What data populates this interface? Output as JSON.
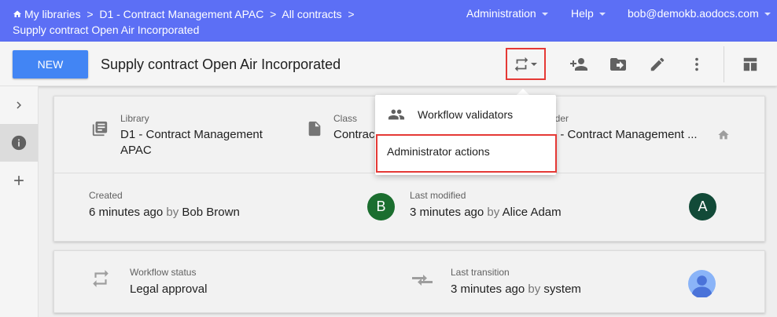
{
  "breadcrumb": {
    "items": [
      "My libraries",
      "D1 - Contract Management APAC",
      "All contracts"
    ],
    "separator": ">",
    "current": "Supply contract Open Air Incorporated"
  },
  "topmenu": {
    "administration": "Administration",
    "help": "Help",
    "user": "bob@demokb.aodocs.com"
  },
  "toolbar": {
    "new_label": "NEW",
    "title": "Supply contract Open Air Incorporated"
  },
  "details": {
    "library_label": "Library",
    "library_value": "D1 - Contract Management APAC",
    "class_label": "Class",
    "class_value": "Contract",
    "folder_label": "Folder",
    "folder_value": "D1 - Contract Management ...",
    "created_label": "Created",
    "created_time": "6 minutes ago",
    "by": "by",
    "created_by": "Bob Brown",
    "created_avatar": "B",
    "modified_label": "Last modified",
    "modified_time": "3 minutes ago",
    "modified_by": "Alice Adam",
    "modified_avatar": "A"
  },
  "workflow": {
    "status_label": "Workflow status",
    "status_value": "Legal approval",
    "transition_label": "Last transition",
    "transition_time": "3 minutes ago",
    "transition_by": "system"
  },
  "menu": {
    "items": [
      "Workflow validators",
      "Administrator actions"
    ]
  },
  "colors": {
    "header": "#5c6ff5",
    "primary_button": "#4285f4",
    "highlight": "#e53935",
    "avatar_b": "#1b6e2f",
    "avatar_a": "#124a38"
  }
}
